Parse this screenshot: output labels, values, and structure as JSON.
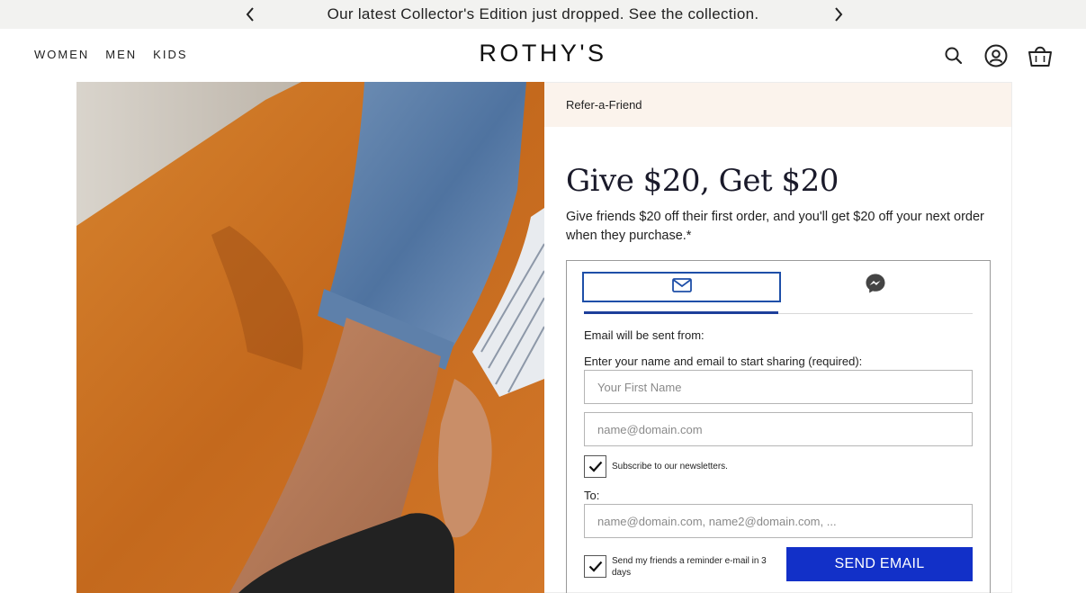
{
  "announcement": {
    "message": "Our latest Collector's Edition just dropped. See the collection.",
    "prev_icon": "chevron-left-icon",
    "next_icon": "chevron-right-icon"
  },
  "header": {
    "nav": [
      {
        "label": "WOMEN"
      },
      {
        "label": "MEN"
      },
      {
        "label": "KIDS"
      }
    ],
    "logo": "ROTHY'S",
    "icons": [
      "search-icon",
      "account-icon",
      "shopping-bag-icon"
    ]
  },
  "referral": {
    "section_label": "Refer-a-Friend",
    "title": "Give $20, Get $20",
    "subtitle": "Give friends $20 off their first order, and you'll get $20 off your next order when they purchase.*",
    "tabs": [
      {
        "icon": "envelope-icon",
        "active": true
      },
      {
        "icon": "messenger-icon",
        "active": false
      }
    ],
    "sent_from_label": "Email will be sent from:",
    "instructions": "Enter your name and email to start sharing (required):",
    "first_name_placeholder": "Your First Name",
    "email_placeholder": "name@domain.com",
    "newsletter_label": "Subscribe to our newsletters.",
    "newsletter_checked": true,
    "to_label": "To:",
    "to_placeholder": "name@domain.com, name2@domain.com, ...",
    "reminder_label": "Send my friends a reminder e-mail in 3 days",
    "reminder_checked": true,
    "send_button": "SEND EMAIL"
  },
  "colors": {
    "accent_blue": "#1230c8",
    "tab_border": "#1e4fa8",
    "refer_bar_bg": "#fbf3ec",
    "announcement_bg": "#f2f2f0"
  }
}
